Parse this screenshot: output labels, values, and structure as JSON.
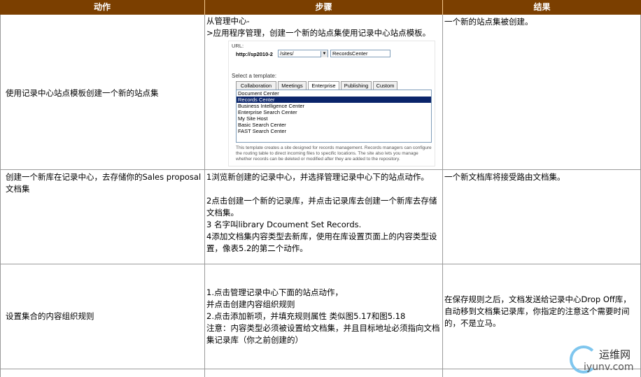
{
  "headers": {
    "action": "动作",
    "steps": "步骤",
    "result": "结果"
  },
  "rows": [
    {
      "action": "使用记录中心站点模板创建一个新的站点集",
      "steps": [
        "从管理中心-",
        ">应用程序管理，创建一个新的站点集使用记录中心站点模板。"
      ],
      "result": "一个新的站点集被创建。"
    },
    {
      "action": "创建一个新库在记录中心，去存储你的Sales proposal 文档集",
      "steps": [
        "1浏览新创建的记录中心，并选择管理记录中心下的站点动作。",
        "2点击创建一个新的记录库，并点击记录库去创建一个新库去存储文档集。",
        "3 名字叫library Dcoument Set Records.",
        "4添加文档集内容类型去新库，使用在库设置页面上的内容类型设置，像表5.2的第二个动作。"
      ],
      "result": "一个新文档库将接受路由文档集。"
    },
    {
      "action": "设置集合的内容组织规则",
      "steps": [
        "1.点击管理记录中心下面的站点动作，",
        "并点击创建内容组织规则",
        "2.点击添加新项，并填充规则属性 类似图5.17和图5.18",
        "注意：内容类型必须被设置给文档集，并且目标地址必须指向文档集记录库（你之前创建的）"
      ],
      "result": "在保存规则之后，文档发送给记录中心Drop Off库，自动移到文档集记录库，你指定的注意这个需要时间的，不是立马。"
    }
  ],
  "screenshot": {
    "url_label": "URL:",
    "url_host": "http://sp2010-2",
    "url_path": "/sites/",
    "url_name": "RecordsCenter",
    "select_label": "Select a template:",
    "tabs": [
      "Collaboration",
      "Meetings",
      "Enterprise",
      "Publishing",
      "Custom"
    ],
    "templates": [
      "Document Center",
      "Records Center",
      "Business Intelligence Center",
      "Enterprise Search Center",
      "My Site Host",
      "Basic Search Center",
      "FAST Search Center"
    ],
    "description": "This template creates a site designed for records management. Records managers can configure the routing table to direct incoming files to specific locations. The site also lets you manage whether records can be deleted or modified after they are added to the repository."
  },
  "watermark": {
    "cn": "运维网",
    "en": "iyunv.com"
  }
}
